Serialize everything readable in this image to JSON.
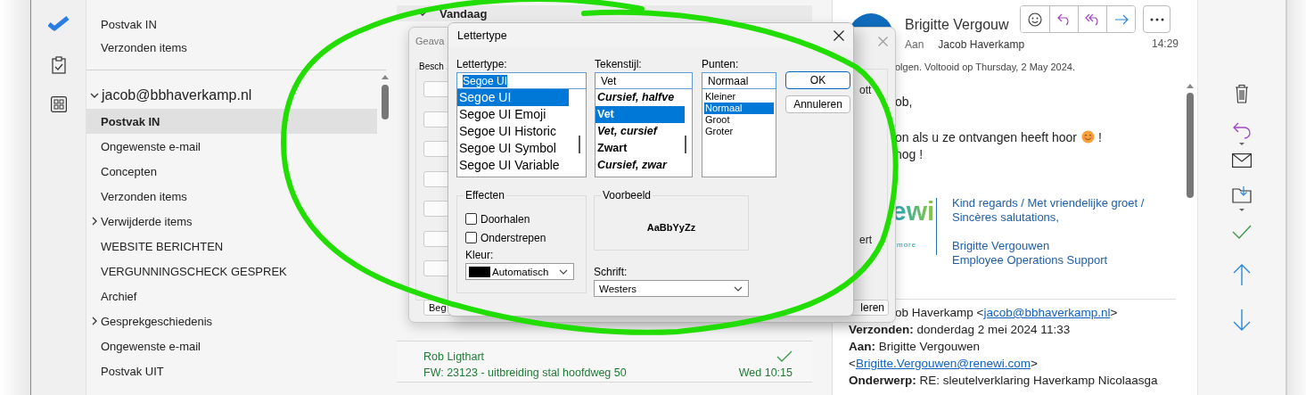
{
  "folder_pane": {
    "favorites": [
      {
        "label": "Postvak IN"
      },
      {
        "label": "Verzonden items"
      }
    ],
    "account": {
      "label": "jacob@bbhaverkamp.nl",
      "expanded": true
    },
    "folders": [
      {
        "label": "Postvak IN",
        "selected": true,
        "has_subfolders": false
      },
      {
        "label": "Ongewenste e-mail",
        "selected": false,
        "has_subfolders": false
      },
      {
        "label": "Concepten",
        "selected": false,
        "has_subfolders": false
      },
      {
        "label": "Verzonden items",
        "selected": false,
        "has_subfolders": false
      },
      {
        "label": "Verwijderde items",
        "selected": false,
        "has_subfolders": true
      },
      {
        "label": "WEBSITE BERICHTEN",
        "selected": false,
        "has_subfolders": false
      },
      {
        "label": "VERGUNNINGSCHECK GESPREK",
        "selected": false,
        "has_subfolders": false
      },
      {
        "label": "Archief",
        "selected": false,
        "has_subfolders": false
      },
      {
        "label": "Gesprekgeschiedenis",
        "selected": false,
        "has_subfolders": true
      },
      {
        "label": "Ongewenste e-mail",
        "selected": false,
        "has_subfolders": false
      },
      {
        "label": "Postvak UIT",
        "selected": false,
        "has_subfolders": false
      }
    ]
  },
  "message_list": {
    "group": "Vandaag",
    "group_expanded": true,
    "messages": [
      {
        "sender": "Rob Ligthart",
        "subject": "FW: 23123 - uitbreiding stal hoofdweg 50",
        "time": "Wed 10:15",
        "completed": true
      }
    ]
  },
  "reading_pane": {
    "sender": "Brigitte Vergouw",
    "to_label": "Aan",
    "recipient": "Jacob Haverkamp",
    "time": "14:29",
    "flag_note": "olgen.  Voltooid op Thursday, 2 May 2024.",
    "body": [
      {
        "text": "ob,"
      },
      {
        "text": "on als u ze ontvangen heeft hoor",
        "emoji": true,
        "tail": "!"
      },
      {
        "text": "nog !"
      }
    ],
    "logo": {
      "text": "ewi",
      "tagline": "more"
    },
    "signature_greeting": [
      "Kind regards / Met vriendelijke groet /",
      "Sincères salutations,"
    ],
    "signature_name": [
      "Brigitte Vergouwen",
      "Employee Operations Support"
    ],
    "original_header": [
      {
        "before": "ob Haverkamp <",
        "link": "jacob@bbhaverkamp.nl",
        "after": ">",
        "indent": true
      },
      {
        "text": "**Verzonden:** donderdag 2 mei 2024 11:33"
      },
      {
        "text": "**Aan:** Brigitte Vergouwen"
      },
      {
        "before": "<",
        "link": "Brigitte.Vergouwen@renewi.com",
        "after": ">"
      },
      {
        "text": "**Onderwerp:** RE: sleutelverklaring Haverkamp Nicolaasga"
      }
    ]
  },
  "back_dialog": {
    "title": "Geava",
    "group_label": "Besch",
    "left_button": "Beg",
    "right_texts": [
      "ott",
      "ert"
    ],
    "right_button": "leren"
  },
  "font_dialog": {
    "title": "Lettertype",
    "font": {
      "label": "Lettertype:",
      "value": "Segoe UI",
      "options": [
        {
          "label": "Segoe UI",
          "selected": true
        },
        {
          "label": "Segoe UI Emoji",
          "selected": false
        },
        {
          "label": "Segoe UI Historic",
          "selected": false
        },
        {
          "label": "Segoe UI Symbol",
          "selected": false
        },
        {
          "label": "Segoe UI Variable",
          "selected": false
        }
      ]
    },
    "style": {
      "label": "Tekenstijl:",
      "value": "Vet",
      "options": [
        {
          "label": "Cursief, halfve",
          "kind": "bold-italic",
          "selected": false
        },
        {
          "label": "Vet",
          "kind": "bold",
          "selected": true
        },
        {
          "label": "Vet, cursief",
          "kind": "bold-italic",
          "selected": false
        },
        {
          "label": "Zwart",
          "kind": "black",
          "selected": false
        },
        {
          "label": "Cursief, zwar",
          "kind": "black-italic",
          "selected": false
        }
      ]
    },
    "size": {
      "label": "Punten:",
      "value": "Normaal",
      "options": [
        {
          "label": "Kleiner",
          "selected": false
        },
        {
          "label": "Normaal",
          "selected": true
        },
        {
          "label": "Groot",
          "selected": false
        },
        {
          "label": "Groter",
          "selected": false
        }
      ]
    },
    "ok": "OK",
    "cancel": "Annuleren",
    "effects": {
      "title": "Effecten",
      "options": [
        {
          "label": "Doorhalen",
          "checked": false
        },
        {
          "label": "Onderstrepen",
          "checked": false
        }
      ],
      "color_label": "Kleur:",
      "color_value": "Automatisch"
    },
    "preview": {
      "title": "Voorbeeld",
      "sample": "AaBbYyZz"
    },
    "script": {
      "label": "Schrift:",
      "value": "Westers"
    }
  }
}
